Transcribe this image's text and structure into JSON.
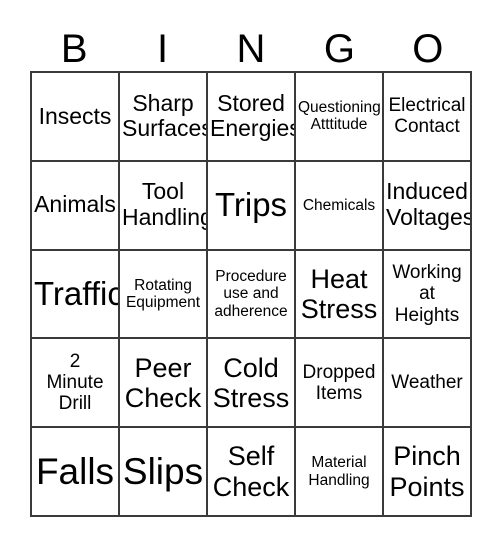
{
  "card": {
    "header_letters": [
      "B",
      "I",
      "N",
      "G",
      "O"
    ],
    "rows": [
      [
        {
          "text": "Insects",
          "size": "md"
        },
        {
          "text": "Sharp\nSurfaces",
          "size": "md"
        },
        {
          "text": "Stored\nEnergies",
          "size": "md"
        },
        {
          "text": "Questioning\nAtttitude",
          "size": "xs"
        },
        {
          "text": "Electrical\nContact",
          "size": "sm"
        }
      ],
      [
        {
          "text": "Animals",
          "size": "md"
        },
        {
          "text": "Tool\nHandling",
          "size": "md"
        },
        {
          "text": "Trips",
          "size": "xl"
        },
        {
          "text": "Chemicals",
          "size": "xs"
        },
        {
          "text": "Induced\nVoltages",
          "size": "md"
        }
      ],
      [
        {
          "text": "Traffic",
          "size": "xl"
        },
        {
          "text": "Rotating\nEquipment",
          "size": "xs"
        },
        {
          "text": "Procedure\nuse and\nadherence",
          "size": "xs"
        },
        {
          "text": "Heat\nStress",
          "size": "lg"
        },
        {
          "text": "Working\nat\nHeights",
          "size": "sm"
        }
      ],
      [
        {
          "text": "2\nMinute\nDrill",
          "size": "sm"
        },
        {
          "text": "Peer\nCheck",
          "size": "lg"
        },
        {
          "text": "Cold\nStress",
          "size": "lg"
        },
        {
          "text": "Dropped\nItems",
          "size": "sm"
        },
        {
          "text": "Weather",
          "size": "sm"
        }
      ],
      [
        {
          "text": "Falls",
          "size": "xxl"
        },
        {
          "text": "Slips",
          "size": "xxl"
        },
        {
          "text": "Self\nCheck",
          "size": "lg"
        },
        {
          "text": "Material\nHandling",
          "size": "xs"
        },
        {
          "text": "Pinch\nPoints",
          "size": "lg"
        }
      ]
    ]
  },
  "colors": {
    "border": "#3a3a3a",
    "text": "#000000",
    "background": "#ffffff"
  }
}
